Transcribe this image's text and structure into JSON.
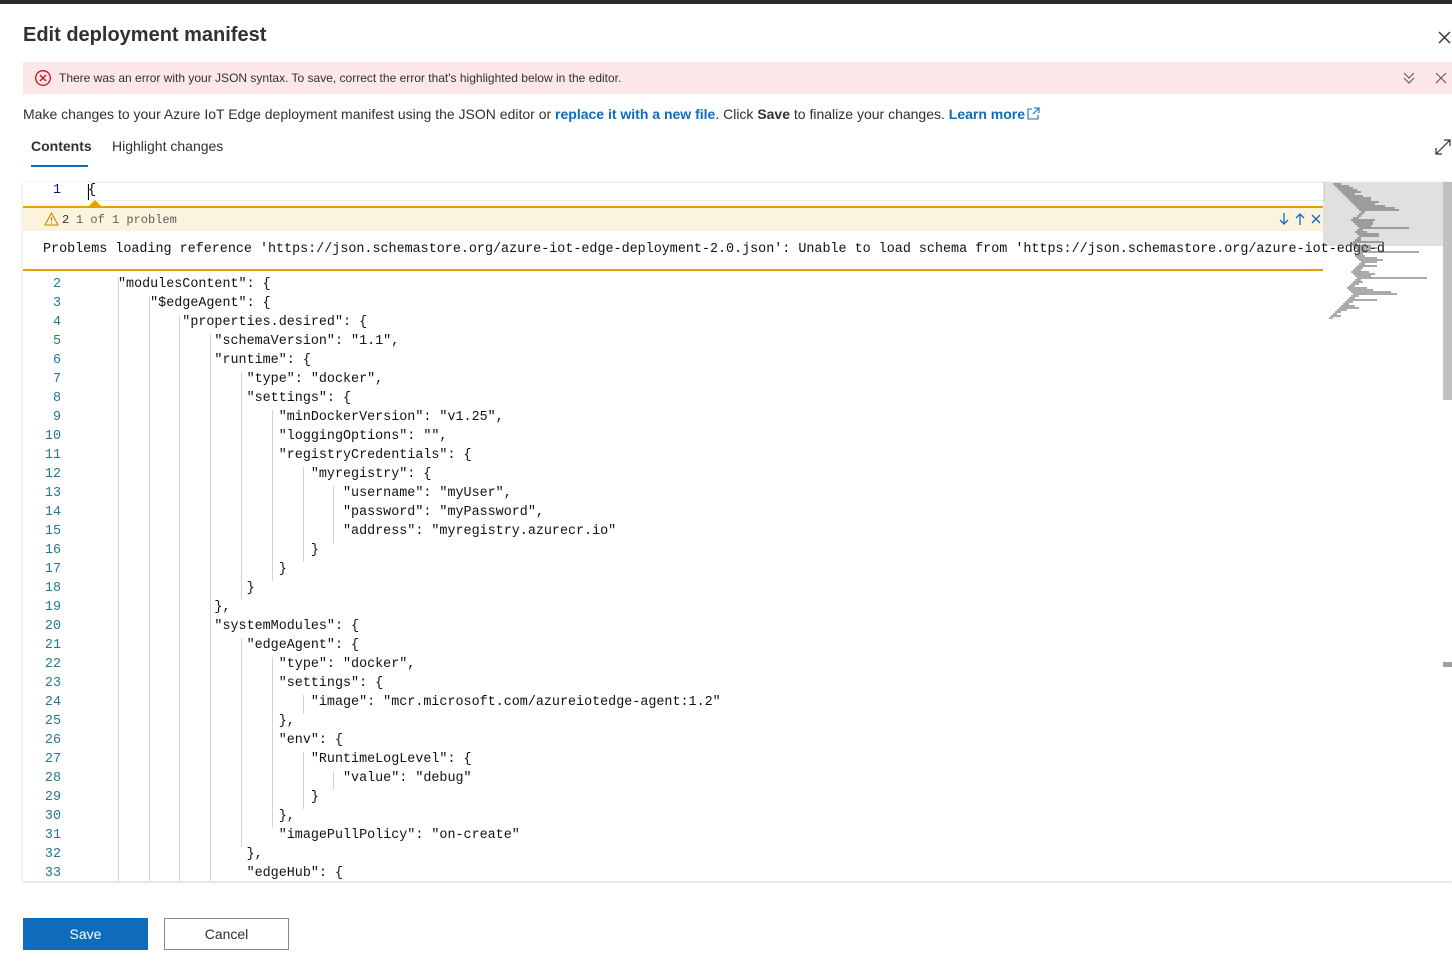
{
  "dialog": {
    "title": "Edit deployment manifest"
  },
  "error": {
    "message": "There was an error with your JSON syntax. To save, correct the error that's highlighted below in the editor."
  },
  "description": {
    "before": "Make changes to your Azure IoT Edge deployment manifest using the JSON editor or ",
    "replace_link": "replace it with a new file",
    "middle": ". Click ",
    "save_word": "Save",
    "after": " to finalize your changes. ",
    "learn_more": "Learn more"
  },
  "tabs": [
    {
      "label": "Contents",
      "selected": true
    },
    {
      "label": "Highlight changes",
      "selected": false
    }
  ],
  "editor": {
    "first_line": {
      "number": "1",
      "text": "{"
    },
    "problem": {
      "count": "2",
      "label": "1 of 1 problem",
      "message": "Problems loading reference 'https://json.schemastore.org/azure-iot-edge-deployment-2.0.json': Unable to load schema from 'https://json.schemastore.org/azure-iot-edge-d"
    },
    "lines": [
      {
        "n": "2",
        "text": "\"modulesContent\": {"
      },
      {
        "n": "3",
        "text": "    \"$edgeAgent\": {"
      },
      {
        "n": "4",
        "text": "        \"properties.desired\": {"
      },
      {
        "n": "5",
        "text": "            \"schemaVersion\": \"1.1\","
      },
      {
        "n": "6",
        "text": "            \"runtime\": {"
      },
      {
        "n": "7",
        "text": "                \"type\": \"docker\","
      },
      {
        "n": "8",
        "text": "                \"settings\": {"
      },
      {
        "n": "9",
        "text": "                    \"minDockerVersion\": \"v1.25\","
      },
      {
        "n": "10",
        "text": "                    \"loggingOptions\": \"\","
      },
      {
        "n": "11",
        "text": "                    \"registryCredentials\": {"
      },
      {
        "n": "12",
        "text": "                        \"myregistry\": {"
      },
      {
        "n": "13",
        "text": "                            \"username\": \"myUser\","
      },
      {
        "n": "14",
        "text": "                            \"password\": \"myPassword\","
      },
      {
        "n": "15",
        "text": "                            \"address\": \"myregistry.azurecr.io\""
      },
      {
        "n": "16",
        "text": "                        }"
      },
      {
        "n": "17",
        "text": "                    }"
      },
      {
        "n": "18",
        "text": "                }"
      },
      {
        "n": "19",
        "text": "            },"
      },
      {
        "n": "20",
        "text": "            \"systemModules\": {"
      },
      {
        "n": "21",
        "text": "                \"edgeAgent\": {"
      },
      {
        "n": "22",
        "text": "                    \"type\": \"docker\","
      },
      {
        "n": "23",
        "text": "                    \"settings\": {"
      },
      {
        "n": "24",
        "text": "                        \"image\": \"mcr.microsoft.com/azureiotedge-agent:1.2\""
      },
      {
        "n": "25",
        "text": "                    },"
      },
      {
        "n": "26",
        "text": "                    \"env\": {"
      },
      {
        "n": "27",
        "text": "                        \"RuntimeLogLevel\": {"
      },
      {
        "n": "28",
        "text": "                            \"value\": \"debug\""
      },
      {
        "n": "29",
        "text": "                        }"
      },
      {
        "n": "30",
        "text": "                    },"
      },
      {
        "n": "31",
        "text": "                    \"imagePullPolicy\": \"on-create\""
      },
      {
        "n": "32",
        "text": "                },"
      },
      {
        "n": "33",
        "text": "                \"edgeHub\": {"
      }
    ]
  },
  "buttons": {
    "save": "Save",
    "cancel": "Cancel"
  },
  "colors": {
    "accent": "#0f6cbd",
    "error_bg": "#fde7e9",
    "error_icon": "#c50f1f",
    "warning": "#e5a100",
    "line_number": "#237893"
  },
  "icons": {
    "close": "close-icon",
    "error": "error-circle-icon",
    "expand": "double-chevron-down-icon",
    "external": "open-external-icon",
    "fullscreen": "expand-diagonal-icon",
    "warning": "warning-triangle-icon"
  }
}
